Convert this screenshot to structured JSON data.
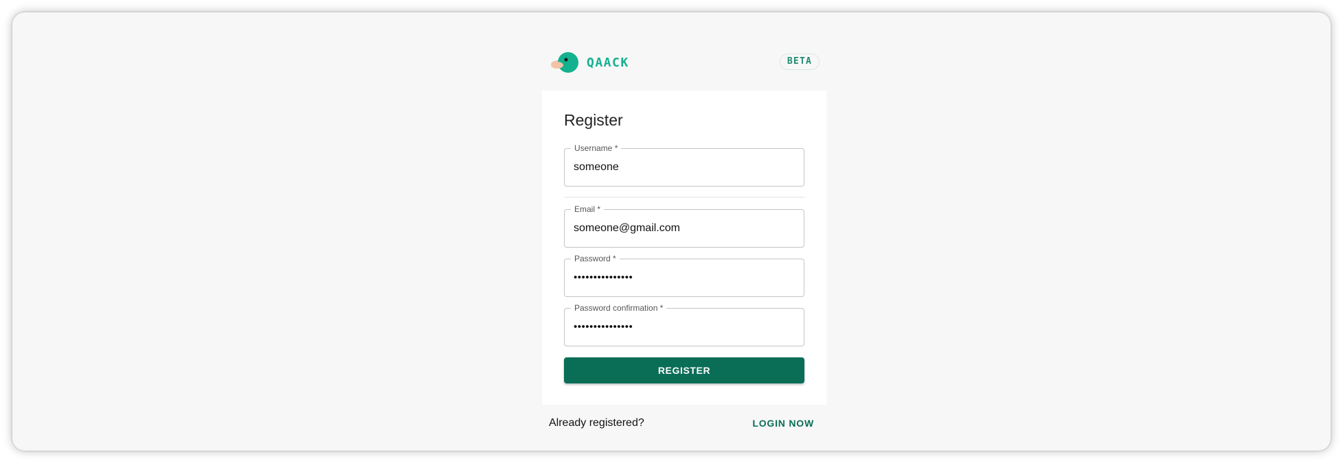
{
  "brand": {
    "name": "QAACK",
    "badge": "BETA",
    "logo_icon": "duck-icon",
    "accent_color": "#14b18f"
  },
  "form": {
    "title": "Register",
    "fields": [
      {
        "label": "Username *",
        "value": "someone",
        "type": "text"
      },
      {
        "label": "Email *",
        "value": "someone@gmail.com",
        "type": "email"
      },
      {
        "label": "Password *",
        "value": "•••••••••••••••",
        "type": "password"
      },
      {
        "label": "Password confirmation *",
        "value": "•••••••••••••••",
        "type": "password"
      }
    ],
    "submit_label": "REGISTER",
    "button_color": "#0a6e57"
  },
  "footer": {
    "prompt": "Already registered?",
    "link_label": "LOGIN NOW"
  }
}
